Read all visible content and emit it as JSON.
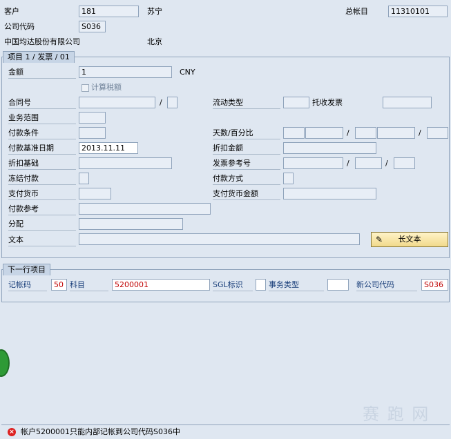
{
  "header": {
    "customer_label": "客户",
    "customer_value": "181",
    "customer_name": "苏宁",
    "gl_label": "总帐目",
    "gl_value": "11310101",
    "company_code_label": "公司代码",
    "company_code_value": "S036",
    "company_name": "中国均达股份有限公司",
    "city": "北京"
  },
  "item_group": {
    "title": "项目 1 / 发票 / 01",
    "amount_label": "金额",
    "amount_value": "1",
    "currency": "CNY",
    "calc_tax_label": "计算税额",
    "contract_label": "合同号",
    "slash": "/",
    "flow_type_label": "流动类型",
    "collection_invoice_label": "托收发票",
    "business_area_label": "业务范围",
    "payment_terms_label": "付款条件",
    "days_percent_label": "天数/百分比",
    "baseline_date_label": "付款基准日期",
    "baseline_date_value": "2013.11.11",
    "discount_amount_label": "折扣金额",
    "discount_base_label": "折扣基础",
    "invoice_ref_label": "发票参考号",
    "payment_block_label": "冻结付款",
    "payment_method_label": "付款方式",
    "payment_currency_label": "支付货币",
    "payment_currency_amount_label": "支付货币金额",
    "payment_ref_label": "付款参考",
    "assignment_label": "分配",
    "text_label": "文本",
    "long_text_button": "长文本"
  },
  "next_item": {
    "title": "下一行项目",
    "posting_key_label": "记帐码",
    "posting_key_value": "50",
    "account_label": "科目",
    "account_value": "5200001",
    "sgl_label": "SGL标识",
    "trans_type_label": "事务类型",
    "new_company_label": "新公司代码",
    "new_company_value": "S036"
  },
  "status": {
    "message": "帐户5200001只能内部记帐到公司代码S036中",
    "icon": "error-icon"
  },
  "watermark": "赛 跑 网"
}
